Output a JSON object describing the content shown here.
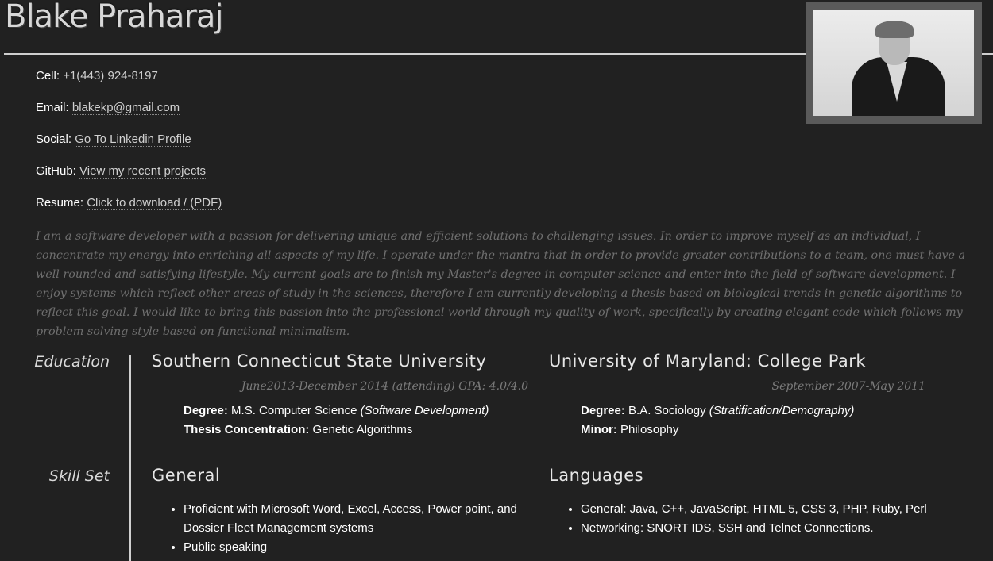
{
  "header": {
    "name": "Blake Praharaj"
  },
  "contacts": [
    {
      "label": "Cell:",
      "value": "+1(443) 924-8197"
    },
    {
      "label": "Email:",
      "value": "blakekp@gmail.com"
    },
    {
      "label": "Social:",
      "value": "Go To Linkedin Profile"
    },
    {
      "label": "GitHub:",
      "value": "View my recent projects"
    },
    {
      "label": "Resume:",
      "value": "Click to download / (PDF)"
    }
  ],
  "bio": "I am a software developer with a passion for delivering unique and efficient solutions to challenging issues. In order to improve myself as an individual, I concentrate my energy into enriching all aspects of my life. I operate under the mantra that in order to provide greater contributions to a team, one must have a well rounded and satisfying lifestyle. My current goals are to finish my Master's degree in computer science and enter into the field of software development. I enjoy systems which reflect other areas of study in the sciences, therefore I am currently developing a thesis based on biological trends in genetic algorithms to reflect this goal. I would like to bring this passion into the professional world through my quality of work, specifically by creating elegant code which follows my problem solving style based on functional minimalism.",
  "education": {
    "title": "Education",
    "schools": [
      {
        "name": "Southern Connecticut State University",
        "dates": "June2013-December 2014 (attending) GPA: 4.0/4.0",
        "line1_label": "Degree:",
        "line1_value": "M.S. Computer Science",
        "line1_note": "(Software Development)",
        "line2_label": "Thesis Concentration:",
        "line2_value": "Genetic Algorithms"
      },
      {
        "name": "University of Maryland: College Park",
        "dates": "September 2007-May 2011",
        "line1_label": "Degree:",
        "line1_value": "B.A. Sociology",
        "line1_note": "(Stratification/Demography)",
        "line2_label": "Minor:",
        "line2_value": "Philosophy"
      }
    ]
  },
  "skills": {
    "title": "Skill Set",
    "general": {
      "heading": "General",
      "items": [
        "Proficient with Microsoft Word, Excel, Access, Power point, and Dossier Fleet Management systems",
        "Public speaking"
      ]
    },
    "languages": {
      "heading": "Languages",
      "items": [
        "General: Java, C++, JavaScript, HTML 5, CSS 3, PHP, Ruby, Perl",
        "Networking: SNORT IDS, SSH and Telnet Connections."
      ]
    }
  }
}
